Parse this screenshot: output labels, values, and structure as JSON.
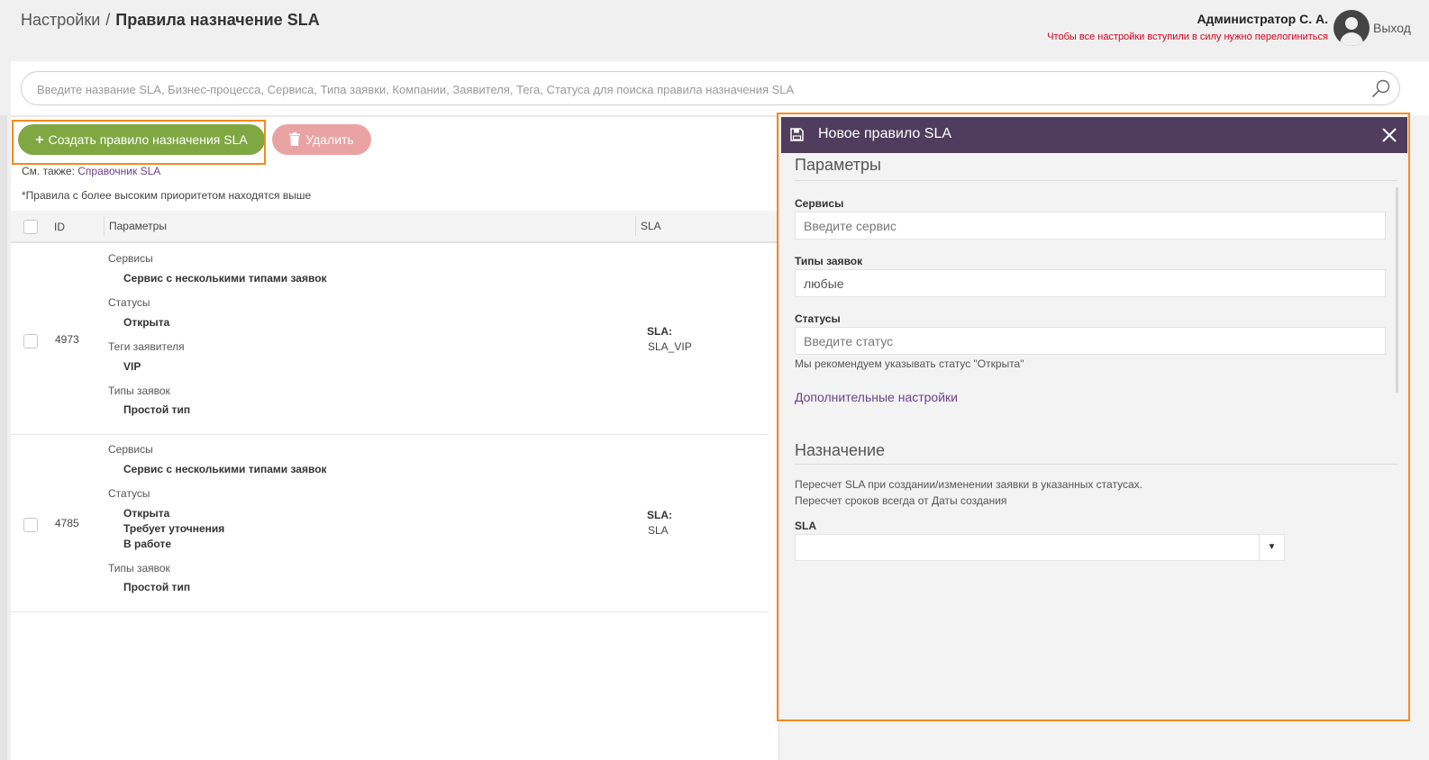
{
  "header": {
    "breadcrumb_root": "Настройки",
    "breadcrumb_sep": "/",
    "breadcrumb_current": "Правила назначение SLA",
    "user_name": "Администратор С. А.",
    "relogin_notice": "Чтобы все настройки вступили в силу нужно перелогиниться",
    "logout_label": "Выход"
  },
  "search": {
    "placeholder": "Введите название SLA, Бизнес-процесса, Сервиса, Типа заявки, Компании, Заявителя, Тега, Статуса для поиска правила назначения SLA",
    "value": ""
  },
  "toolbar": {
    "create_label": "Создать правило назначения SLA",
    "create_plus": "+",
    "delete_label": "Удалить"
  },
  "see_also": {
    "prefix": "См. также:",
    "link": "Справочник SLA"
  },
  "priority_note": "*Правила с более высоким приоритетом находятся выше",
  "table": {
    "columns": [
      "ID",
      "Параметры",
      "SLA"
    ],
    "rows": [
      {
        "id": "4973",
        "params": [
          {
            "label": "Сервисы",
            "values": [
              "Сервис с несколькими типами заявок"
            ]
          },
          {
            "label": "Статусы",
            "values": [
              "Открыта"
            ]
          },
          {
            "label": "Теги заявителя",
            "values": [
              "VIP"
            ]
          },
          {
            "label": "Типы заявок",
            "values": [
              "Простой тип"
            ]
          }
        ],
        "sla_label": "SLA:",
        "sla_value": "SLA_VIP"
      },
      {
        "id": "4785",
        "params": [
          {
            "label": "Сервисы",
            "values": [
              "Сервис с несколькими типами заявок"
            ]
          },
          {
            "label": "Статусы",
            "values": [
              "Открыта",
              "Требует уточнения",
              "В работе"
            ]
          },
          {
            "label": "Типы заявок",
            "values": [
              "Простой тип"
            ]
          }
        ],
        "sla_label": "SLA:",
        "sla_value": "SLA"
      }
    ]
  },
  "panel": {
    "title": "Новое правило SLA",
    "params_title": "Параметры",
    "services_label": "Сервисы",
    "services_placeholder": "Введите сервис",
    "types_label": "Типы заявок",
    "types_value": "любые",
    "statuses_label": "Статусы",
    "statuses_placeholder": "Введите статус",
    "status_hint": "Мы рекомендуем указывать статус \"Открыта\"",
    "advanced_link": "Дополнительные настройки",
    "assign_title": "Назначение",
    "recalc_note_1": "Пересчет SLA при создании/изменении заявки в указанных статусах.",
    "recalc_note_2": "Пересчет сроков всегда от Даты создания",
    "sla_label": "SLA",
    "sla_value": ""
  },
  "colors": {
    "accent_green": "#7fa843",
    "delete_pink": "#eaa3a3",
    "panel_header": "#503d5e",
    "highlight_orange": "#f7891f",
    "link_purple": "#6b3f8f",
    "warning_red": "#d0021b"
  }
}
